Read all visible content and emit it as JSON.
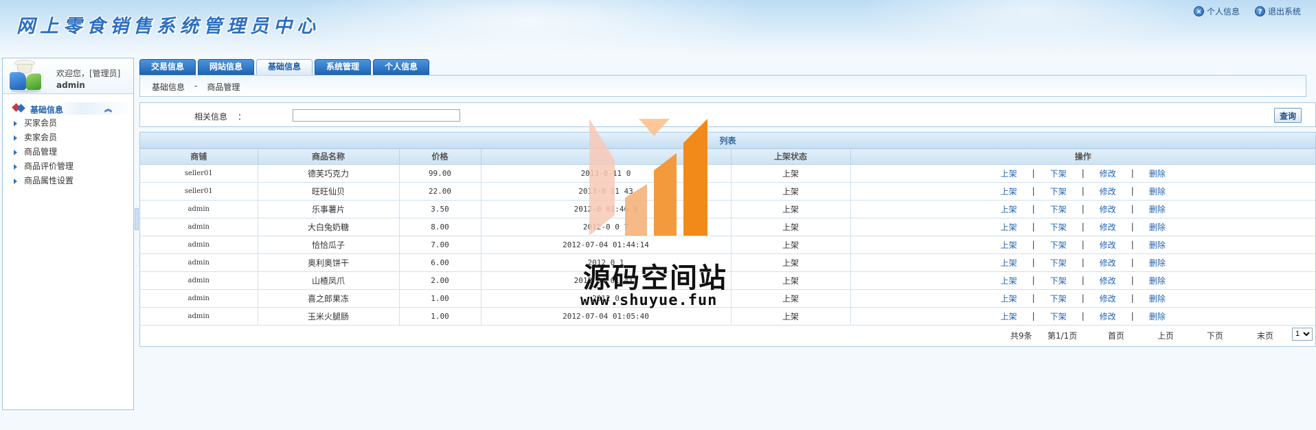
{
  "header": {
    "title": "网上零食销售系统管理员中心",
    "links": [
      {
        "label": "个人信息",
        "icon": "close-circle-icon"
      },
      {
        "label": "退出系统",
        "icon": "help-circle-icon"
      }
    ]
  },
  "sidebar": {
    "welcome": "欢迎您，[管理员]",
    "username": "admin",
    "section_label": "基础信息",
    "items": [
      {
        "label": "买家会员"
      },
      {
        "label": "卖家会员"
      },
      {
        "label": "商品管理"
      },
      {
        "label": "商品评价管理"
      },
      {
        "label": "商品属性设置"
      }
    ]
  },
  "tabs": [
    {
      "label": "交易信息",
      "active": false
    },
    {
      "label": "网站信息",
      "active": false
    },
    {
      "label": "基础信息",
      "active": true
    },
    {
      "label": "系统管理",
      "active": false
    },
    {
      "label": "个人信息",
      "active": false
    }
  ],
  "breadcrumb": {
    "level1": "基础信息",
    "separator": "-",
    "level2": "商品管理"
  },
  "search": {
    "label": "相关信息",
    "colon": "：",
    "value": "",
    "button_label": "查询"
  },
  "table": {
    "title": "列表",
    "columns": [
      "商铺",
      "商品名称",
      "价格",
      "",
      "上架状态",
      "操作"
    ],
    "rows": [
      {
        "shop": "seller01",
        "name": "德芙巧克力",
        "price": "99.00",
        "time": "2013-0  11   0",
        "status": "上架"
      },
      {
        "shop": "seller01",
        "name": "旺旺仙贝",
        "price": "22.00",
        "time": "2013-0  11   43",
        "status": "上架"
      },
      {
        "shop": "admin",
        "name": "乐事薯片",
        "price": "3.50",
        "time": "2012-0  01:46  9",
        "status": "上架"
      },
      {
        "shop": "admin",
        "name": "大白兔奶糖",
        "price": "8.00",
        "time": "2012-0  0   7",
        "status": "上架"
      },
      {
        "shop": "admin",
        "name": "恰恰瓜子",
        "price": "7.00",
        "time": "2012-07-04 01:44:14",
        "status": "上架"
      },
      {
        "shop": "admin",
        "name": "奥利奥饼干",
        "price": "6.00",
        "time": "2012  0   1",
        "status": "上架"
      },
      {
        "shop": "admin",
        "name": "山楂凤爪",
        "price": "2.00",
        "time": "2012  04 01:41:  ",
        "status": "上架"
      },
      {
        "shop": "admin",
        "name": "喜之郎果冻",
        "price": "1.00",
        "time": "2012  0  ",
        "status": "上架"
      },
      {
        "shop": "admin",
        "name": "玉米火腿肠",
        "price": "1.00",
        "time": "2012-07-04 01:05:40",
        "status": "上架"
      }
    ],
    "ops": {
      "up": "上架",
      "down": "下架",
      "edit": "修改",
      "delete": "删除",
      "separator": "|"
    }
  },
  "pager": {
    "total": "共9条",
    "page_info": "第1/1页",
    "first": "首页",
    "prev": "上页",
    "next": "下页",
    "last": "末页",
    "selected_page": "1"
  },
  "watermark": {
    "text": "源码空间站",
    "url": "www.shuyue.fun"
  },
  "colors": {
    "accent": "#1f64b5",
    "link": "#1f63b3",
    "border": "#a9c9e4",
    "watermark_orange": "#f28a1a"
  }
}
